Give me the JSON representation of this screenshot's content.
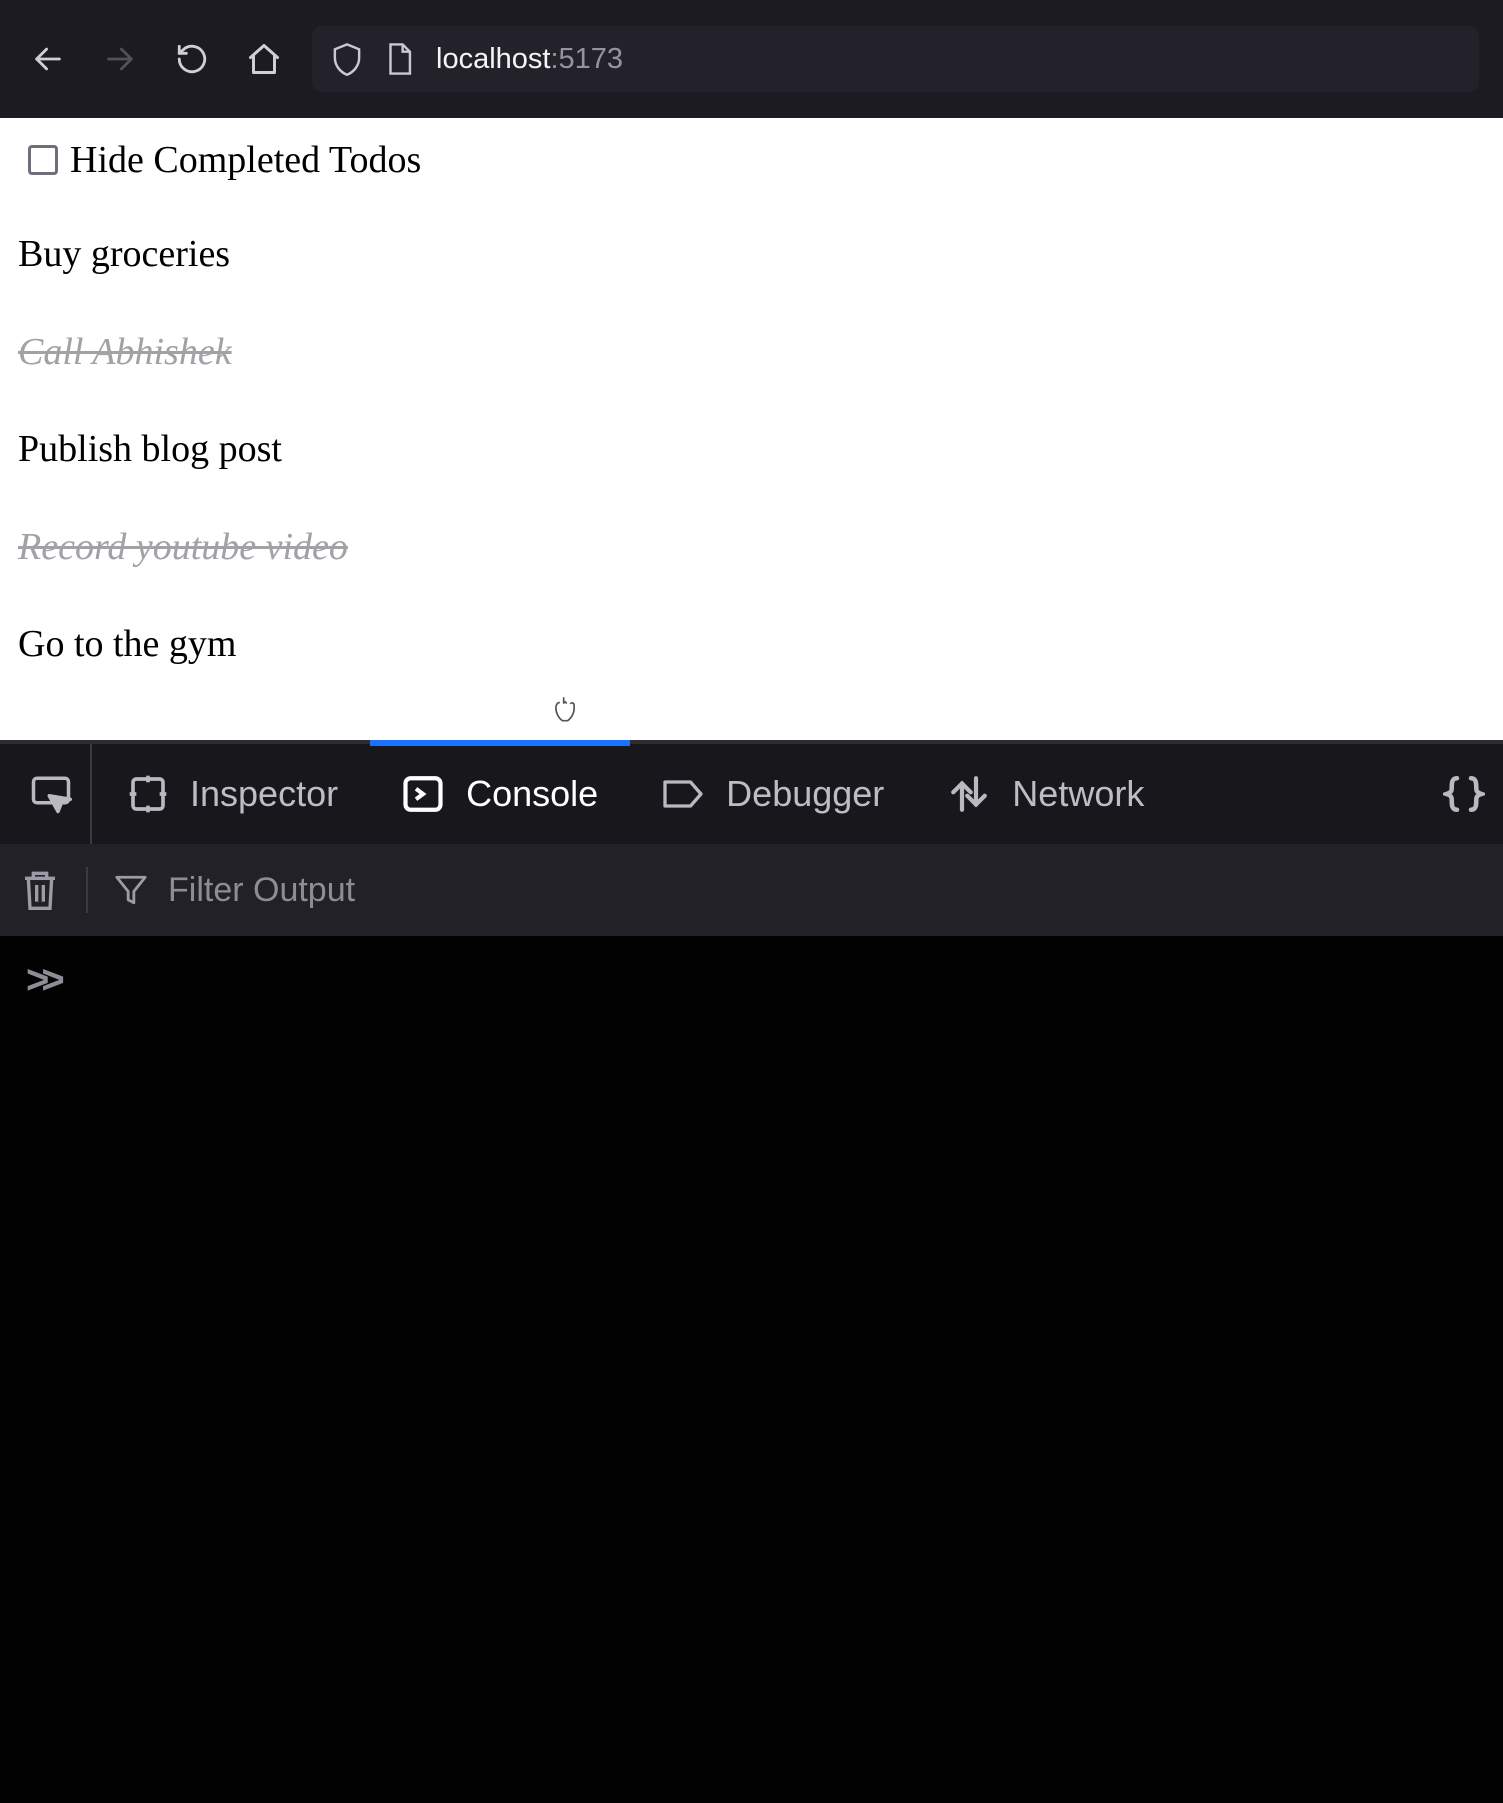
{
  "browser": {
    "url_host": "localhost",
    "url_port": ":5173"
  },
  "page": {
    "filter_label": "Hide Completed Todos",
    "filter_checked": false,
    "todos": [
      {
        "text": "Buy groceries",
        "done": false
      },
      {
        "text": "Call Abhishek",
        "done": true
      },
      {
        "text": "Publish blog post",
        "done": false
      },
      {
        "text": "Record youtube video",
        "done": true
      },
      {
        "text": "Go to the gym",
        "done": false
      }
    ]
  },
  "devtools": {
    "tabs": {
      "inspector": "Inspector",
      "console": "Console",
      "debugger": "Debugger",
      "network": "Network"
    },
    "active_tab": "console",
    "filter_placeholder": "Filter Output",
    "prompt": ">>"
  }
}
